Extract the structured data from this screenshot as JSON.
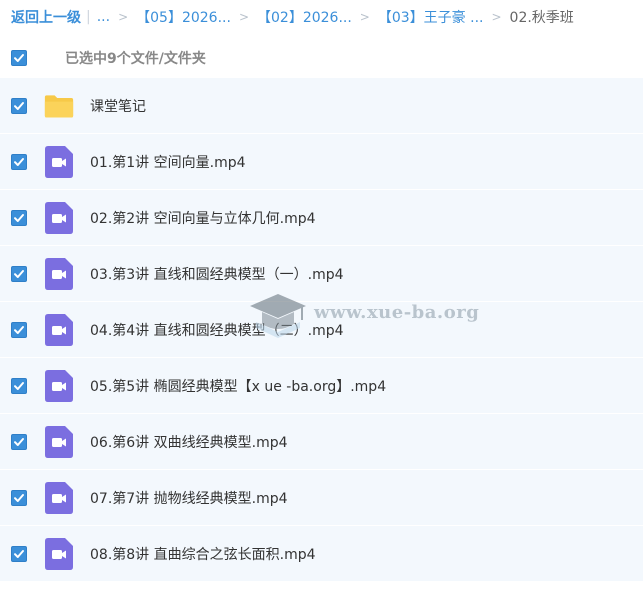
{
  "breadcrumb": {
    "back_label": "返回上一级",
    "separator_bar": "|",
    "ellipsis": "...",
    "chevron": ">",
    "crumbs": [
      "【05】2026...",
      "【02】2026...",
      "【03】王子豪 ..."
    ],
    "current": "02.秋季班"
  },
  "selection": {
    "label": "已选中9个文件/文件夹"
  },
  "files": [
    {
      "name": "课堂笔记",
      "type": "folder"
    },
    {
      "name": "01.第1讲 空间向量.mp4",
      "type": "video"
    },
    {
      "name": "02.第2讲 空间向量与立体几何.mp4",
      "type": "video"
    },
    {
      "name": "03.第3讲 直线和圆经典模型（一）.mp4",
      "type": "video"
    },
    {
      "name": "04.第4讲 直线和圆经典模型（二）.mp4",
      "type": "video"
    },
    {
      "name": "05.第5讲 椭圆经典模型【x ue -ba.org】.mp4",
      "type": "video"
    },
    {
      "name": "06.第6讲 双曲线经典模型.mp4",
      "type": "video"
    },
    {
      "name": "07.第7讲 抛物线经典模型.mp4",
      "type": "video"
    },
    {
      "name": "08.第8讲 直曲综合之弦长面积.mp4",
      "type": "video"
    }
  ],
  "watermark": {
    "text": "www.xue-ba.org",
    "icon": "graduation-cap-icon"
  },
  "colors": {
    "accent": "#3b8fd9",
    "row_bg": "#f3f8fd",
    "video_icon": "#7b6ee0",
    "folder_icon": "#f7c948"
  }
}
